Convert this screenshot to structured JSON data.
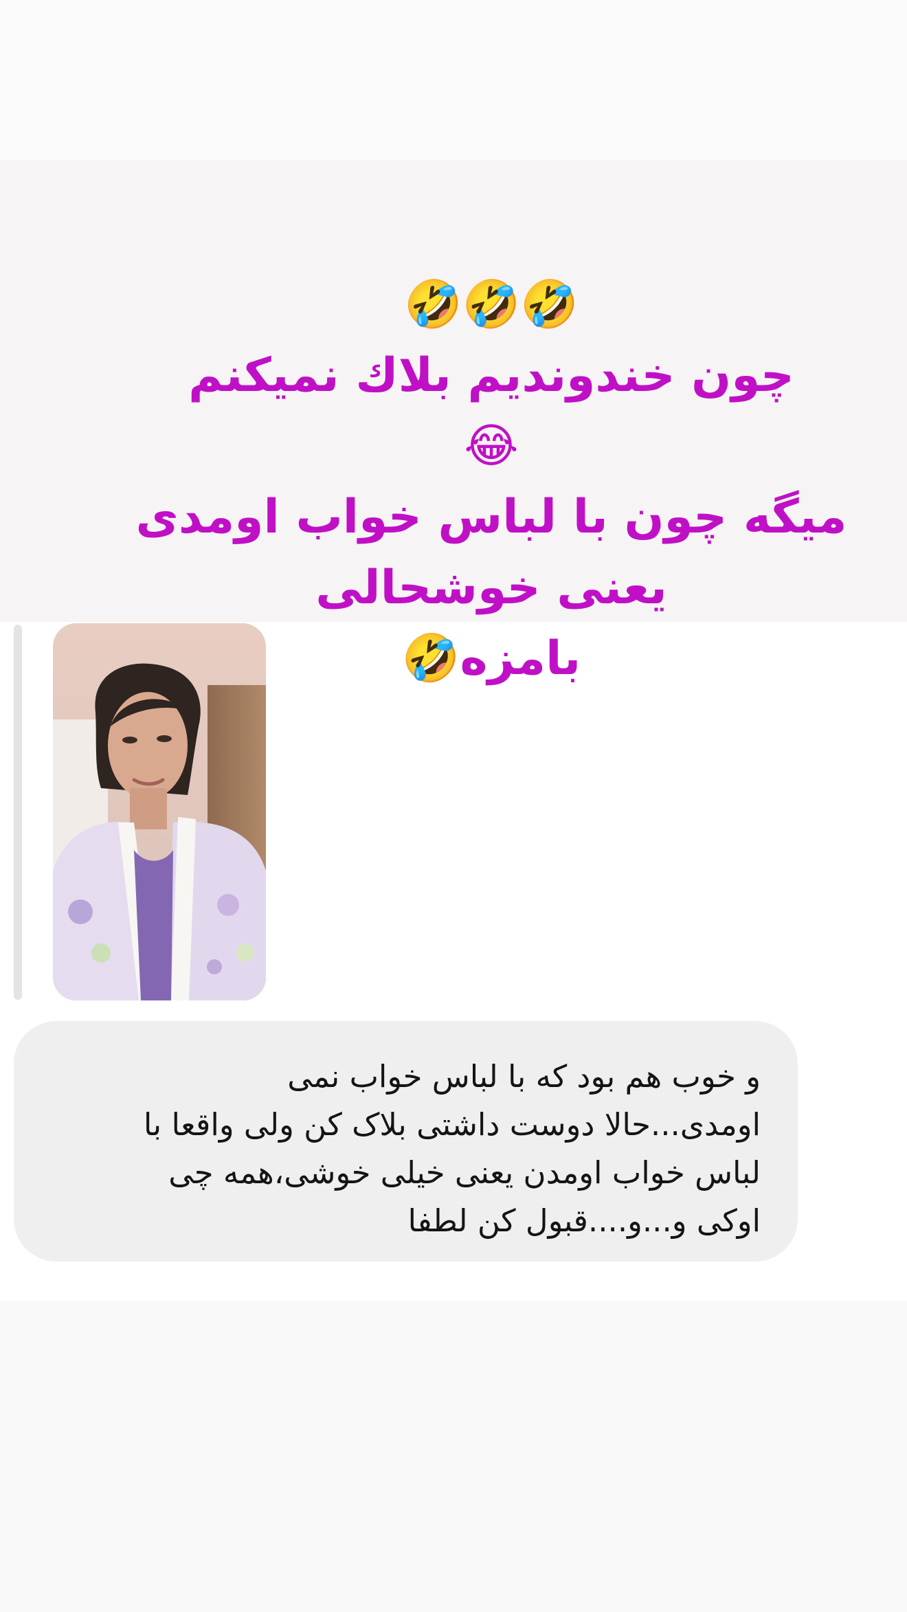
{
  "story_caption": {
    "color": "#c010c6",
    "lines": [
      "🤣🤣🤣",
      "چون خندوندیم بلاك نمیكنم",
      "😂",
      "میگه چون با لباس خواب اومدی",
      "یعنی خوشحالی",
      "بامزه🤣"
    ]
  },
  "story_reply": {
    "thumbnail_alt": "story thumbnail"
  },
  "message": {
    "text": "و خوب هم بود که با لباس خواب نمی\nاومدی...حالا دوست داشتی بلاک کن ولی واقعا با\nلباس خواب اومدن یعنی خیلی خوشی،همه چی\nاوکی و...و....قبول کن لطفا",
    "bubble_color": "#efefef"
  }
}
